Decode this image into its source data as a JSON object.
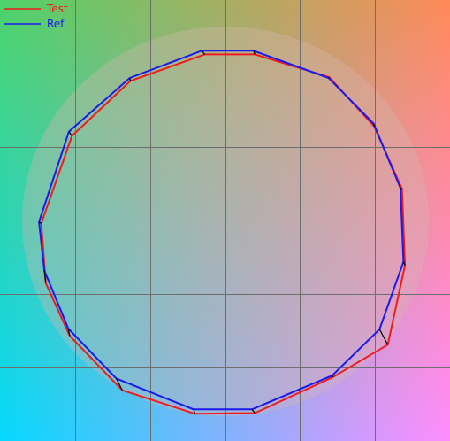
{
  "chart_data": {
    "type": "line",
    "title": "",
    "xlabel": "",
    "ylabel": "",
    "grid": true,
    "legend_placement": "top-left",
    "background_corner_colors": {
      "top_left": "#4fd36a",
      "top_right": "#ff8a5a",
      "bottom_left": "#05d8ff",
      "bottom_right": "#ff8cff"
    },
    "xlim": [
      0,
      6
    ],
    "ylim": [
      0,
      6
    ],
    "grid_x": [
      1,
      2,
      3,
      4,
      5
    ],
    "grid_y": [
      1,
      2,
      3,
      4,
      5
    ],
    "series": [
      {
        "name": "Test",
        "color": "#ee1c1c",
        "points": [
          [
            2.73,
            5.26
          ],
          [
            3.4,
            5.26
          ],
          [
            4.39,
            4.95
          ],
          [
            4.99,
            4.28
          ],
          [
            5.36,
            3.43
          ],
          [
            5.4,
            2.39
          ],
          [
            5.17,
            1.31
          ],
          [
            4.44,
            0.87
          ],
          [
            3.4,
            0.38
          ],
          [
            2.6,
            0.37
          ],
          [
            1.63,
            0.69
          ],
          [
            0.93,
            1.43
          ],
          [
            0.61,
            2.15
          ],
          [
            0.55,
            2.96
          ],
          [
            0.96,
            4.15
          ],
          [
            1.74,
            4.9
          ],
          [
            2.73,
            5.26
          ]
        ]
      },
      {
        "name": "Ref.",
        "color": "#1a1aee",
        "points": [
          [
            2.69,
            5.31
          ],
          [
            3.38,
            5.31
          ],
          [
            4.38,
            4.94
          ],
          [
            4.98,
            4.32
          ],
          [
            5.34,
            3.44
          ],
          [
            5.38,
            2.44
          ],
          [
            5.06,
            1.52
          ],
          [
            4.43,
            0.89
          ],
          [
            3.36,
            0.43
          ],
          [
            2.58,
            0.43
          ],
          [
            1.55,
            0.85
          ],
          [
            0.91,
            1.53
          ],
          [
            0.59,
            2.32
          ],
          [
            0.52,
            2.98
          ],
          [
            0.92,
            4.21
          ],
          [
            1.73,
            4.94
          ],
          [
            2.69,
            5.31
          ]
        ]
      }
    ]
  }
}
